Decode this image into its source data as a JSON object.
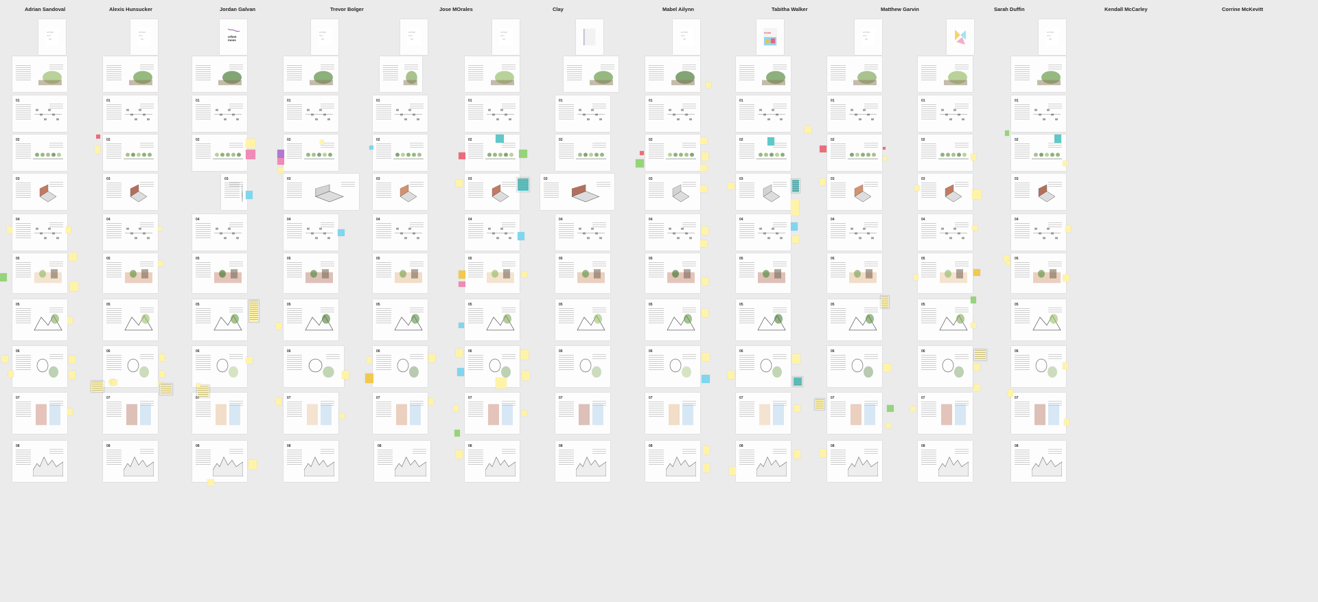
{
  "board": {
    "columns": [
      {
        "name": "Adrian Sandoval"
      },
      {
        "name": "Alexis Hunsucker"
      },
      {
        "name": "Jordan Galvan"
      },
      {
        "name": "Trevor Bolger"
      },
      {
        "name": "Jose MOrales"
      },
      {
        "name": "Clay"
      },
      {
        "name": "Mabel Ailynn"
      },
      {
        "name": "Tabitha Walker"
      },
      {
        "name": "Matthew Garvin"
      },
      {
        "name": "Sarah Duffin"
      },
      {
        "name": "Kendall McCarley"
      },
      {
        "name": "Corrine McKevitt"
      }
    ],
    "page_labels": [
      "",
      "",
      "01",
      "02",
      "03",
      "04",
      "05",
      "05",
      "06",
      "07",
      "08"
    ],
    "colors": {
      "background": "#ebebeb",
      "sticky_yellow": "#fff3a8",
      "sticky_pink": "#f08bb5",
      "sticky_blue": "#7fd6ef",
      "sticky_green": "#96d47a",
      "sticky_teal": "#5fc8c8",
      "sticky_red": "#ec6d7a",
      "sticky_purple": "#b07ad0",
      "sticky_orange": "#f2c94c"
    }
  }
}
